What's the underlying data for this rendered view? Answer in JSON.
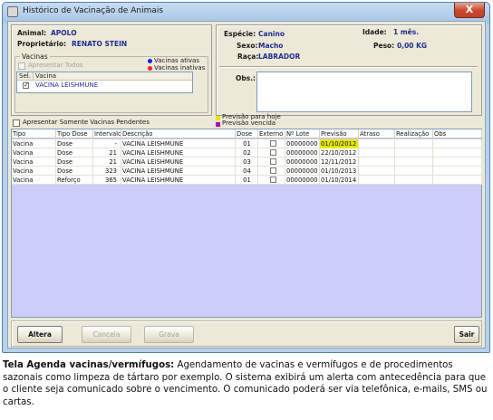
{
  "window": {
    "title": "Histórico de Vacinação de Animais",
    "close_label": "X"
  },
  "animal": {
    "animal_label": "Animal:",
    "animal_value": "APOLO",
    "owner_label": "Proprietário:",
    "owner_value": "RENATO STEIN"
  },
  "vaccines": {
    "group_title": "Vacinas",
    "show_all_label": "Apresentar Todos",
    "legend_active": "Vacinas ativas",
    "legend_inactive": "Vacinas inativas",
    "legend_active_color": "#1a1aff",
    "legend_inactive_color": "#ff2020",
    "columns": [
      "Sel.",
      "Vacina"
    ],
    "rows": [
      {
        "selected": true,
        "name": "VACINA LEISHMUNE"
      }
    ]
  },
  "details": {
    "species_label": "Espécie:",
    "species_value": "Canino",
    "age_label": "Idade:",
    "age_value": "1 mês.",
    "sex_label": "Sexo:",
    "sex_value": "Macho",
    "weight_label": "Peso:",
    "weight_value": "0,00 KG",
    "breed_label": "Raça:",
    "breed_value": "LABRADOR",
    "obs_label": "Obs.:"
  },
  "filters": {
    "pending_only_label": "Apresentar Somente Vacinas Pendentes",
    "legend_today": "Previsão para hoje",
    "legend_overdue": "Previsão vencida",
    "legend_today_color": "#e8e800",
    "legend_overdue_color": "#b000b0"
  },
  "grid": {
    "columns": [
      "Tipo",
      "Tipo Dose",
      "Intervalo",
      "Descrição",
      "Dose",
      "Externo",
      "Nº Lote",
      "Previsão",
      "Atraso",
      "Realização",
      "Obs"
    ],
    "rows": [
      {
        "tipo": "Vacina",
        "tipo_dose": "Dose",
        "intervalo": "-",
        "descricao": "VACINA LEISHMUNE",
        "dose": "01",
        "externo": false,
        "lote": "00000000",
        "previsao": "01/10/2012",
        "highlight": true
      },
      {
        "tipo": "Vacina",
        "tipo_dose": "Dose",
        "intervalo": "21",
        "descricao": "VACINA LEISHMUNE",
        "dose": "02",
        "externo": false,
        "lote": "00000000",
        "previsao": "22/10/2012",
        "highlight": false
      },
      {
        "tipo": "Vacina",
        "tipo_dose": "Dose",
        "intervalo": "21",
        "descricao": "VACINA LEISHMUNE",
        "dose": "03",
        "externo": false,
        "lote": "00000000",
        "previsao": "12/11/2012",
        "highlight": false
      },
      {
        "tipo": "Vacina",
        "tipo_dose": "Dose",
        "intervalo": "323",
        "descricao": "VACINA LEISHMUNE",
        "dose": "04",
        "externo": false,
        "lote": "00000000",
        "previsao": "01/10/2013",
        "highlight": false
      },
      {
        "tipo": "Vacina",
        "tipo_dose": "Reforço",
        "intervalo": "365",
        "descricao": "VACINA LEISHMUNE",
        "dose": "01",
        "externo": false,
        "lote": "00000000",
        "previsao": "01/10/2014",
        "highlight": false
      }
    ]
  },
  "buttons": {
    "alter": "Altera",
    "cancel": "Cancela",
    "save": "Grava",
    "exit": "Sair"
  },
  "caption": {
    "bold": "Tela Agenda vacinas/vermífugos:",
    "text": " Agendamento de vacinas e vermífugos e de procedimentos sazonais como limpeza de tártaro por exemplo. O sistema exibirá um alerta com antecedência para que o cliente seja comunicado sobre o vencimento. O comunicado poderá ser via telefônica, e-mails, SMS ou cartas."
  }
}
